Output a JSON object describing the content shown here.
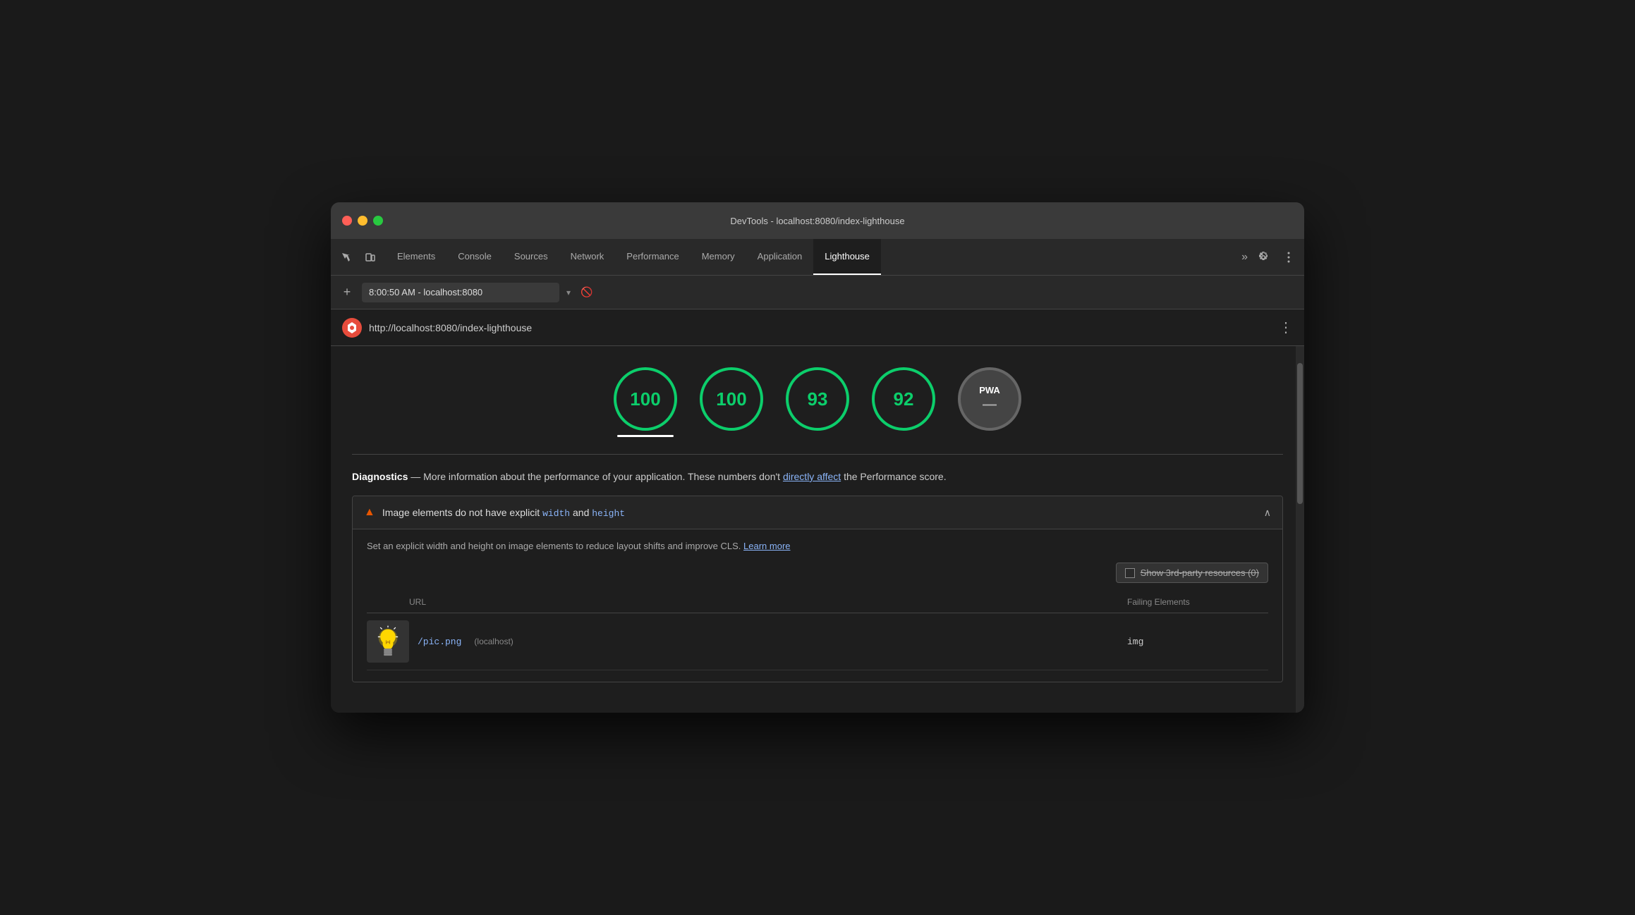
{
  "window": {
    "title": "DevTools - localhost:8080/index-lighthouse"
  },
  "tabs": {
    "items": [
      {
        "id": "elements",
        "label": "Elements",
        "active": false
      },
      {
        "id": "console",
        "label": "Console",
        "active": false
      },
      {
        "id": "sources",
        "label": "Sources",
        "active": false
      },
      {
        "id": "network",
        "label": "Network",
        "active": false
      },
      {
        "id": "performance",
        "label": "Performance",
        "active": false
      },
      {
        "id": "memory",
        "label": "Memory",
        "active": false
      },
      {
        "id": "application",
        "label": "Application",
        "active": false
      },
      {
        "id": "lighthouse",
        "label": "Lighthouse",
        "active": true
      }
    ],
    "more_label": "»"
  },
  "address_bar": {
    "value": "8:00:50 AM - localhost:8080",
    "add_btn": "+"
  },
  "lh_header": {
    "url": "http://localhost:8080/index-lighthouse"
  },
  "scores": [
    {
      "id": "performance",
      "value": "100",
      "active": true
    },
    {
      "id": "accessibility",
      "value": "100",
      "active": false
    },
    {
      "id": "best-practices",
      "value": "93",
      "active": false
    },
    {
      "id": "seo",
      "value": "92",
      "active": false
    },
    {
      "id": "pwa",
      "value": "PWA",
      "dash": "—",
      "gray": true,
      "active": false
    }
  ],
  "diagnostics": {
    "title": "Diagnostics",
    "description": " — More information about the performance of your application. These numbers don't ",
    "link_text": "directly affect",
    "description2": " the Performance score."
  },
  "warning": {
    "title_prefix": "Image elements do not have explicit ",
    "code1": "width",
    "title_mid": " and ",
    "code2": "height",
    "description": "Set an explicit width and height on image elements to reduce layout shifts and improve CLS. ",
    "learn_more": "Learn more",
    "third_party_label": "Show 3rd-party resources (0)",
    "table": {
      "col_url": "URL",
      "col_failing": "Failing Elements",
      "rows": [
        {
          "url": "/pic.png",
          "origin": "(localhost)",
          "failing": "img"
        }
      ]
    }
  }
}
